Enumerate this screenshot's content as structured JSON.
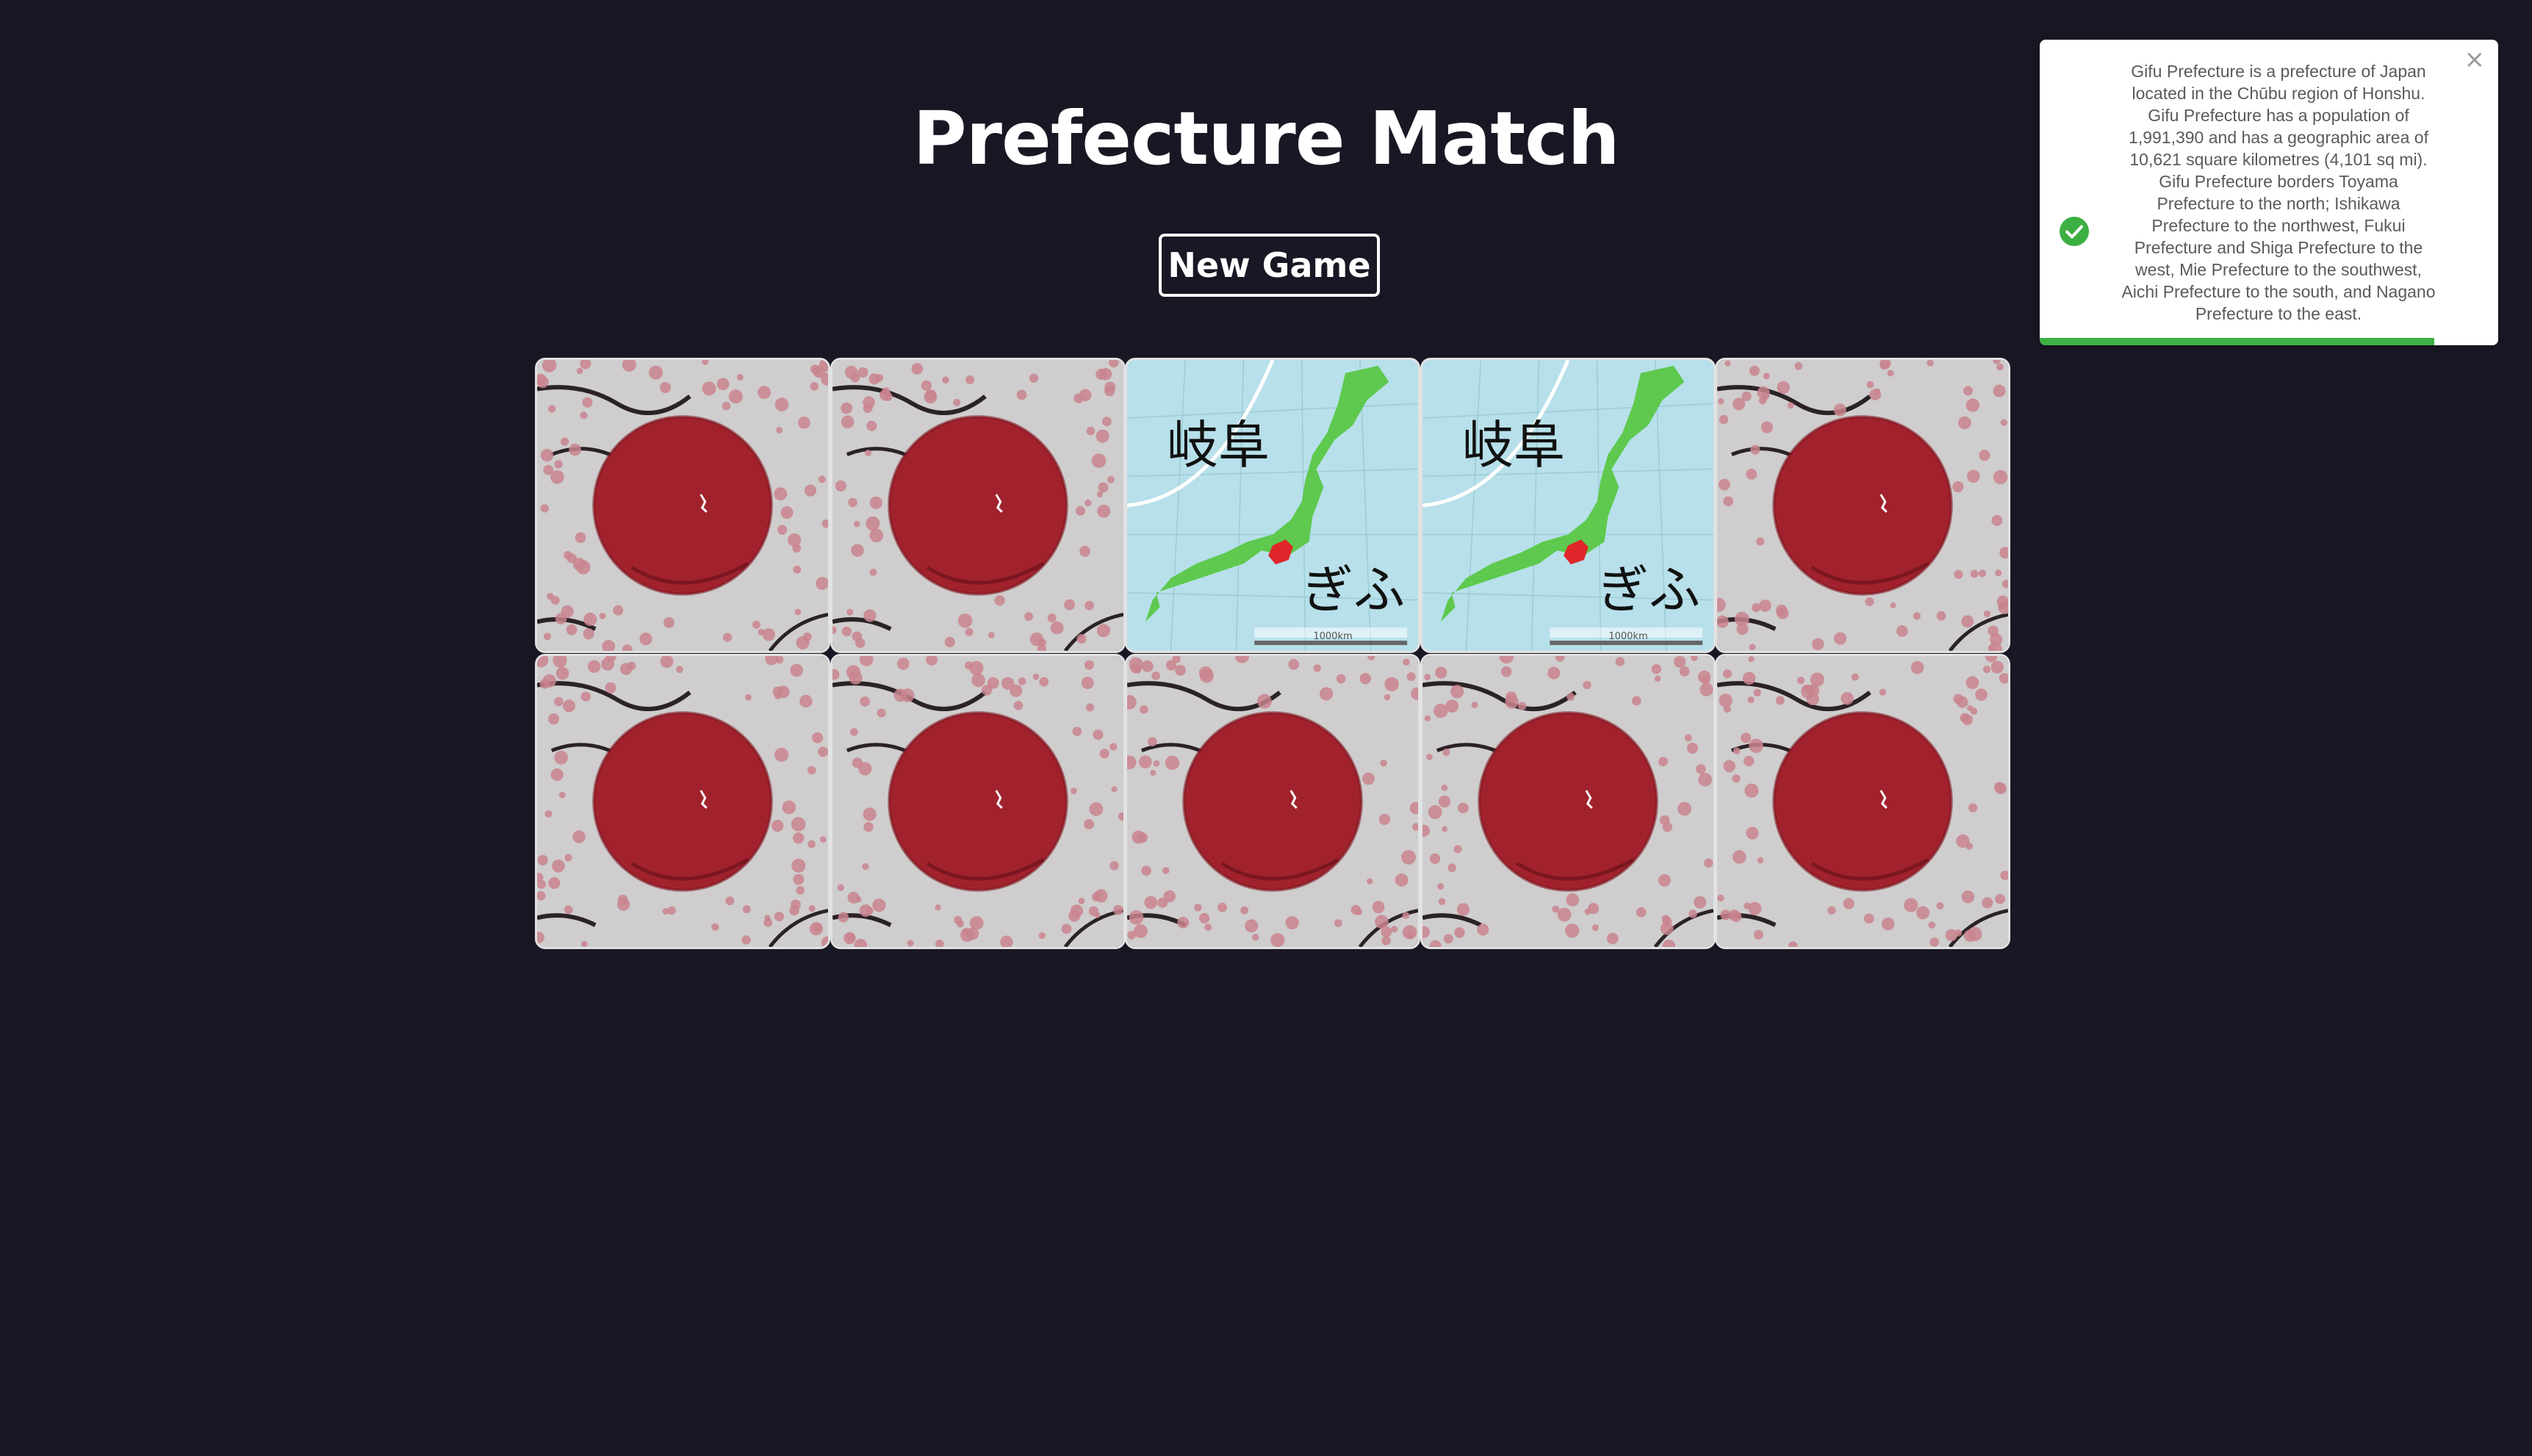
{
  "header": {
    "title": "Prefecture Match",
    "new_game_label": "New Game"
  },
  "board": {
    "columns": 5,
    "rows": 2,
    "cards": [
      {
        "state": "face-down"
      },
      {
        "state": "face-down"
      },
      {
        "state": "face-up",
        "kanji": "岐阜",
        "kana": "ぎふ",
        "scale": "1000km"
      },
      {
        "state": "face-up",
        "kanji": "岐阜",
        "kana": "ぎふ",
        "scale": "1000km"
      },
      {
        "state": "face-down"
      },
      {
        "state": "face-down"
      },
      {
        "state": "face-down"
      },
      {
        "state": "face-down"
      },
      {
        "state": "face-down"
      },
      {
        "state": "face-down"
      }
    ]
  },
  "toast": {
    "message_lines": [
      "Gifu Prefecture is a prefecture of Japan",
      "located in the Chūbu region of Honshu.",
      "Gifu Prefecture has a population of",
      "1,991,390 and has a geographic area of",
      "10,621 square kilometres (4,101 sq mi).",
      "Gifu Prefecture borders Toyama",
      "Prefecture to the north; Ishikawa",
      "Prefecture to the northwest, Fukui",
      "Prefecture and Shiga Prefecture to the",
      "west, Mie Prefecture to the southwest,",
      "Aichi Prefecture to the south, and Nagano",
      "Prefecture to the east."
    ],
    "close_symbol": "×",
    "icon": "check-circle-icon",
    "progress": 0.86,
    "accent_color": "#3cb043"
  },
  "colors": {
    "background": "#191724",
    "card_back_sun": "#a1222d",
    "card_face_sea": "#b7e0ea",
    "card_face_land": "#5ec94e",
    "highlight": "#e0262a"
  }
}
